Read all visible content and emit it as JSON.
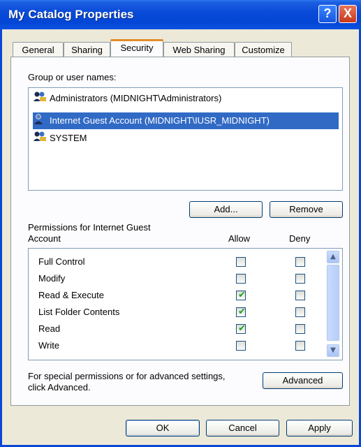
{
  "window": {
    "title": "My Catalog Properties",
    "help_label": "?",
    "close_label": "X"
  },
  "tabs": [
    {
      "label": "General"
    },
    {
      "label": "Sharing"
    },
    {
      "label": "Security"
    },
    {
      "label": "Web Sharing"
    },
    {
      "label": "Customize"
    }
  ],
  "active_tab": "Security",
  "groups": {
    "label": "Group or user names:",
    "items": [
      {
        "label": "Administrators (MIDNIGHT\\Administrators)",
        "icon": "users-group-icon",
        "selected": false
      },
      {
        "label": "Internet Guest Account (MIDNIGHT\\IUSR_MIDNIGHT)",
        "icon": "user-icon",
        "selected": true
      },
      {
        "label": "SYSTEM",
        "icon": "users-group-icon",
        "selected": false
      }
    ]
  },
  "buttons": {
    "add": "Add...",
    "remove": "Remove",
    "advanced": "Advanced",
    "ok": "OK",
    "cancel": "Cancel",
    "apply": "Apply"
  },
  "permissions": {
    "label_line1": "Permissions for Internet Guest",
    "label_line2": "Account",
    "allow_header": "Allow",
    "deny_header": "Deny",
    "rows": [
      {
        "name": "Full Control",
        "allow": false,
        "deny": false
      },
      {
        "name": "Modify",
        "allow": false,
        "deny": false
      },
      {
        "name": "Read & Execute",
        "allow": true,
        "deny": false
      },
      {
        "name": "List Folder Contents",
        "allow": true,
        "deny": false
      },
      {
        "name": "Read",
        "allow": true,
        "deny": false
      },
      {
        "name": "Write",
        "allow": false,
        "deny": false
      }
    ]
  },
  "advanced_text": {
    "line1": "For special permissions or for advanced settings,",
    "line2": "click Advanced."
  },
  "colors": {
    "titlebar": "#0346d5",
    "selection": "#316ac5",
    "active_tab_accent": "#e68b2c",
    "check": "#21a121"
  }
}
